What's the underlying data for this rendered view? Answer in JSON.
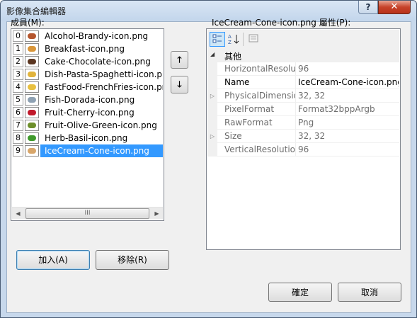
{
  "window": {
    "title": "影像集合編輯器",
    "help_label": "?",
    "close_label": "✕"
  },
  "members": {
    "label": "成員(M):",
    "items": [
      {
        "index": "0",
        "name": "Alcohol-Brandy-icon.png",
        "color": "#b5562e"
      },
      {
        "index": "1",
        "name": "Breakfast-icon.png",
        "color": "#d9963a"
      },
      {
        "index": "2",
        "name": "Cake-Chocolate-icon.png",
        "color": "#5a3520"
      },
      {
        "index": "3",
        "name": "Dish-Pasta-Spaghetti-icon.png",
        "color": "#e2b43c"
      },
      {
        "index": "4",
        "name": "FastFood-FrenchFries-icon.png",
        "color": "#e8c040"
      },
      {
        "index": "5",
        "name": "Fish-Dorada-icon.png",
        "color": "#8ea1b3"
      },
      {
        "index": "6",
        "name": "Fruit-Cherry-icon.png",
        "color": "#c0182a"
      },
      {
        "index": "7",
        "name": "Fruit-Olive-Green-icon.png",
        "color": "#6d8f2a"
      },
      {
        "index": "8",
        "name": "Herb-Basil-icon.png",
        "color": "#3f9a2c"
      },
      {
        "index": "9",
        "name": "IceCream-Cone-icon.png",
        "color": "#d8a66a",
        "selected": true
      }
    ],
    "scroll_grip": "III"
  },
  "buttons": {
    "move_up": "🡑",
    "move_down": "🡓",
    "add": "加入(A)",
    "remove": "移除(R)",
    "ok": "確定",
    "cancel": "取消"
  },
  "properties": {
    "label": "IceCream-Cone-icon.png 屬性(P):",
    "toolbar": {
      "categorized_icon": "categorized-icon",
      "alphabetical_icon": "sort-az-icon",
      "pages_icon": "property-pages-icon"
    },
    "category": "其他",
    "rows": [
      {
        "name": "HorizontalResolution",
        "value": "96",
        "expandable": false,
        "editable": false
      },
      {
        "name": "Name",
        "value": "IceCream-Cone-icon.png",
        "expandable": false,
        "editable": true
      },
      {
        "name": "PhysicalDimension",
        "value": "32, 32",
        "expandable": true,
        "editable": false
      },
      {
        "name": "PixelFormat",
        "value": "Format32bppArgb",
        "expandable": false,
        "editable": false
      },
      {
        "name": "RawFormat",
        "value": "Png",
        "expandable": false,
        "editable": false
      },
      {
        "name": "Size",
        "value": "32, 32",
        "expandable": true,
        "editable": false
      },
      {
        "name": "VerticalResolution",
        "value": "96",
        "expandable": false,
        "editable": false
      }
    ]
  }
}
